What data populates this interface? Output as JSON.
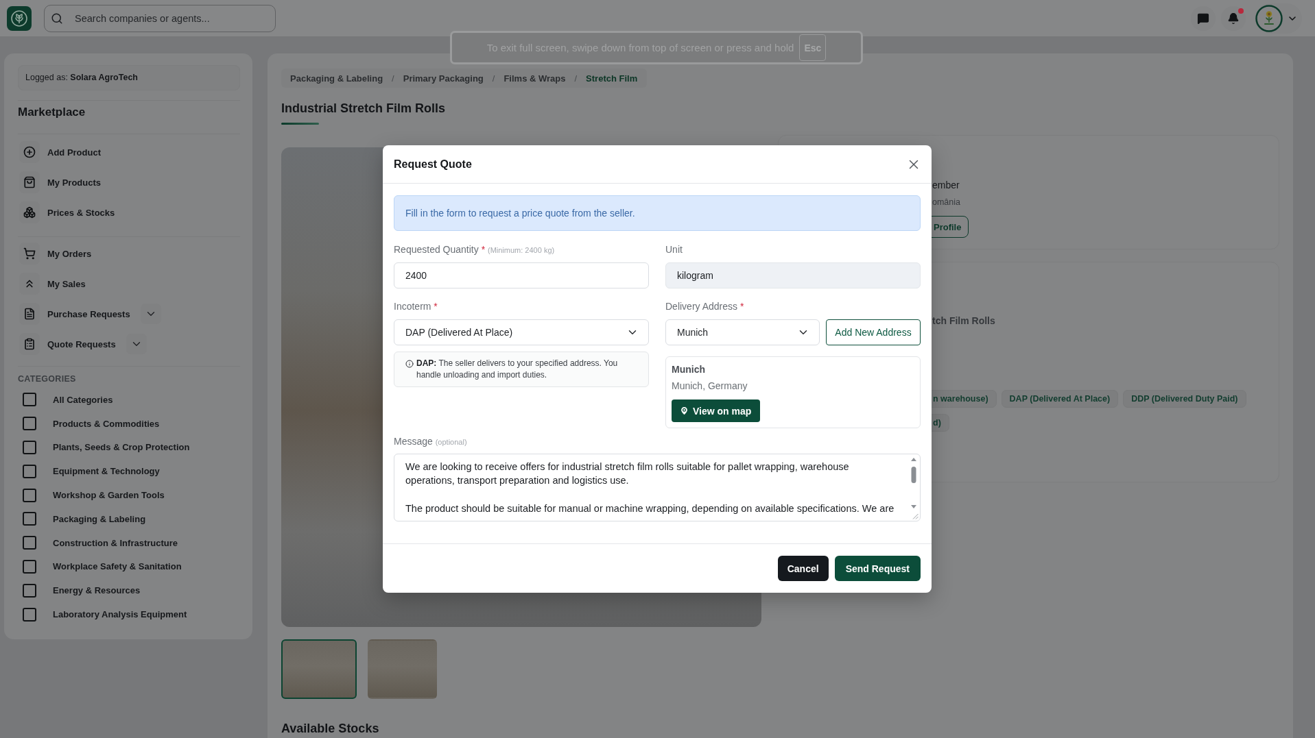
{
  "top_bar": {
    "search": {
      "placeholder": "Search companies or agents..."
    },
    "notifications": {
      "has_unread": true
    }
  },
  "fullscreen_notice": {
    "text": "To exit full screen, swipe down from top of screen or press and hold",
    "key": "Esc"
  },
  "sidebar": {
    "logged_as": "Logged as: **Solara AgroTech**",
    "title": "Marketplace",
    "menu_groups": [
      [
        {
          "label": "Add Product",
          "kind": "link"
        },
        {
          "label": "My Products",
          "kind": "link"
        },
        {
          "label": "Prices & Stocks",
          "kind": "link"
        }
      ],
      [
        {
          "label": "My Orders",
          "kind": "link"
        },
        {
          "label": "My Sales",
          "kind": "link"
        },
        {
          "label": "Purchase Requests",
          "kind": "group",
          "expanded": false
        },
        {
          "label": "Quote Requests",
          "kind": "group",
          "expanded": false
        }
      ]
    ],
    "categories_title": "CATEGORIES",
    "categories": [
      {
        "label": "All Categories",
        "checked": false
      },
      {
        "label": "Products & Commodities",
        "checked": false
      },
      {
        "label": "Plants, Seeds & Crop Protection",
        "checked": false
      },
      {
        "label": "Equipment & Technology",
        "checked": false
      },
      {
        "label": "Workshop & Garden Tools",
        "checked": false
      },
      {
        "label": "Packaging & Labeling",
        "checked": false
      },
      {
        "label": "Construction & Infrastructure",
        "checked": false
      },
      {
        "label": "Workplace Safety & Sanitation",
        "checked": false
      },
      {
        "label": "Energy & Resources",
        "checked": false
      },
      {
        "label": "Laboratory Analysis Equipment",
        "checked": false
      }
    ]
  },
  "main": {
    "breadcrumb": {
      "separator": "/",
      "items": [
        {
          "label": "Packaging & Labeling",
          "current": false
        },
        {
          "label": "Primary Packaging",
          "current": false
        },
        {
          "label": "Films & Wraps",
          "current": false
        },
        {
          "label": "Stretch Film",
          "current": true
        }
      ]
    },
    "title": "Industrial Stretch Film Rolls",
    "gallery": {
      "thumbnails": [
        {
          "selected": true
        },
        {
          "selected": false
        }
      ]
    },
    "seller_card": {
      "line_1": "ember",
      "line_2": "omânia",
      "button": "Profile"
    },
    "product_card": {
      "heading": "tch Film Rolls",
      "chip_rows": [
        [
          "n warehouse)",
          "DAP (Delivered At Place)",
          "DDP (Delivered Duty Paid)"
        ],
        [
          "d)"
        ]
      ]
    },
    "section_heading": "Available Stocks"
  },
  "modal": {
    "title": "Request Quote",
    "info": "Fill in the form to request a price quote from the seller.",
    "quantity": {
      "label": "Requested Quantity",
      "required_mark": "*",
      "hint": "(Minimum: 2400 kg)",
      "value": "2400",
      "disabled": false
    },
    "unit": {
      "label": "Unit",
      "value": "kilogram",
      "disabled": true
    },
    "incoterm": {
      "label": "Incoterm",
      "required_mark": "*",
      "value": "DAP (Delivered At Place)",
      "note": "**DAP:** The seller delivers to your specified address. You handle unloading and import duties."
    },
    "delivery_address": {
      "label": "Delivery Address",
      "required_mark": "*",
      "value": "Munich",
      "add_button": "Add New Address",
      "card": {
        "name": "Munich",
        "location": "Munich, Germany",
        "map_button": "View on map"
      }
    },
    "message": {
      "label": "Message",
      "hint": "(optional)",
      "value": "We are looking to receive offers for industrial stretch film rolls suitable for pallet wrapping, warehouse operations, transport preparation and logistics use.\n\nThe product should be suitable for manual or machine wrapping, depending on available specifications. We are"
    },
    "buttons": [
      {
        "label": "Cancel",
        "kind": "dark"
      },
      {
        "label": "Send Request",
        "kind": "primary"
      }
    ]
  }
}
